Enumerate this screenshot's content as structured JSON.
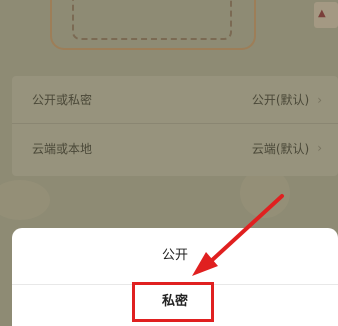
{
  "settings": {
    "rows": [
      {
        "label": "公开或私密",
        "value": "公开(默认)"
      },
      {
        "label": "云端或本地",
        "value": "云端(默认)"
      }
    ],
    "chevron": "›"
  },
  "sheet": {
    "options": [
      {
        "label": "公开"
      },
      {
        "label": "私密"
      }
    ]
  },
  "annotation": {
    "color": "#e02020"
  }
}
